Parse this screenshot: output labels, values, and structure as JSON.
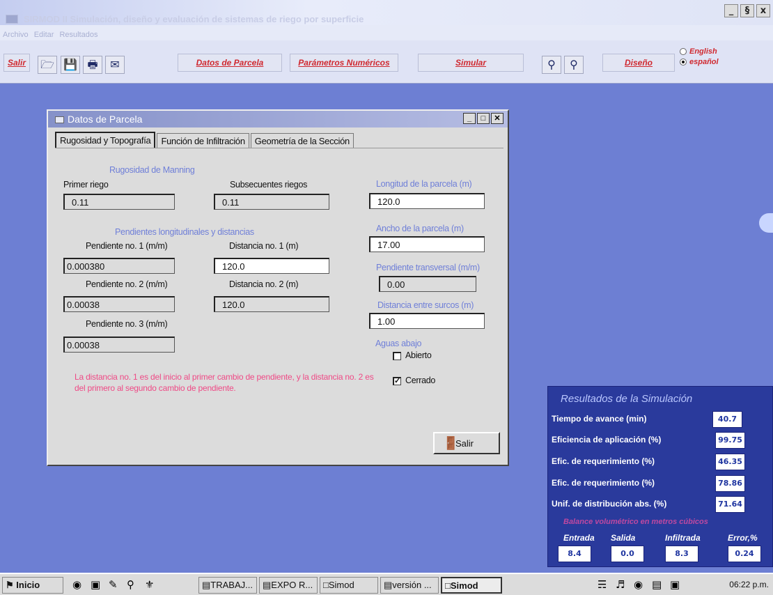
{
  "window": {
    "title": "SIRMOD II    Simulación, diseño y evaluación de sistemas de riego por superficie",
    "minimize": "_",
    "maximize": "§",
    "close": "x"
  },
  "menu": [
    "Archivo",
    "Editar",
    "Resultados"
  ],
  "toolbar": {
    "salir": "Salir",
    "datos_parcela": "Datos de Parcela",
    "parametros": "Parámetros Numéricos",
    "simular": "Simular",
    "diseno": "Diseño",
    "lang_english": "English",
    "lang_espanol": "español",
    "icons": [
      "open-file-icon",
      "save-icon",
      "print-icon",
      "export-icon",
      "help-icon",
      "info-icon"
    ]
  },
  "dialog": {
    "title": "Datos de Parcela",
    "tabs": [
      "Rugosidad y Topografía",
      "Función de Infiltración",
      "Geometría de la Sección"
    ],
    "rugosidad_title": "Rugosidad de Manning",
    "primer_riego_label": "Primer riego",
    "primer_riego_value": "0.11",
    "subsecuentes_label": "Subsecuentes riegos",
    "subsecuentes_value": "0.11",
    "pendientes_title": "Pendientes longitudinales y distancias",
    "pendiente1_label": "Pendiente no. 1 (m/m)",
    "pendiente1_value": "0.000380",
    "distancia1_label": "Distancia no. 1 (m)",
    "distancia1_value": "120.0",
    "pendiente2_label": "Pendiente no. 2 (m/m)",
    "pendiente2_value": "0.00038",
    "distancia2_label": "Distancia no. 2 (m)",
    "distancia2_value": "120.0",
    "pendiente3_label": "Pendiente no. 3 (m/m)",
    "pendiente3_value": "0.00038",
    "longitud_label": "Longitud de la parcela (m)",
    "longitud_value": "120.0",
    "ancho_label": "Ancho de la parcela (m)",
    "ancho_value": "17.00",
    "transversal_label": "Pendiente transversal (m/m)",
    "transversal_value": "0.00",
    "surcos_label": "Distancia entre surcos (m)",
    "surcos_value": "1.00",
    "aguas_label": "Aguas abajo",
    "abierto_label": "Abierto",
    "cerrado_label": "Cerrado",
    "note": "La distancia no. 1 es del inicio al primer cambio de pendiente, y la distancia no. 2 es del primero al segundo cambio de pendiente.",
    "salir_label": "Salir"
  },
  "results": {
    "title": "Resultados de la Simulación",
    "rows": [
      {
        "label": "Tiempo de avance (min)",
        "value": "40.7"
      },
      {
        "label": "Eficiencia de aplicación (%)",
        "value": "99.75"
      },
      {
        "label": "Efic. de requerimiento (%)",
        "value": "46.35"
      },
      {
        "label": "Efic. de requerimiento (%)",
        "value": "78.86"
      },
      {
        "label": "Unif. de distribución abs. (%)",
        "value": "71.64"
      }
    ],
    "balance_title": "Balance volumétrico en metros cúbicos",
    "balance_headers": [
      "Entrada",
      "Salida",
      "Infiltrada",
      "Error,%"
    ],
    "balance_values": [
      "8.4",
      "0.0",
      "8.3",
      "0.24"
    ]
  },
  "taskbar": {
    "start": "Inicio",
    "items": [
      "TRABAJ...",
      "EXPO R...",
      "Simod",
      "versión ...",
      "Simod"
    ],
    "clock": "06:22 p.m."
  }
}
